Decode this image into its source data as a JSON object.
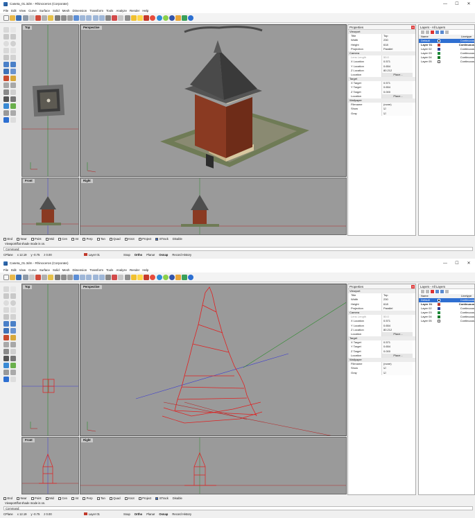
{
  "window": {
    "title": "Caseta_01.3dm - Rhinoceros (Corporate)",
    "minimize": "—",
    "maximize": "☐",
    "close": "✕"
  },
  "menu": [
    "File",
    "Edit",
    "View",
    "Curve",
    "Surface",
    "Solid",
    "Mesh",
    "Dimension",
    "Transform",
    "Tools",
    "Analyze",
    "Render",
    "Help"
  ],
  "viewports": {
    "top": "Top",
    "perspective": "Perspective",
    "front": "Front",
    "right": "Right"
  },
  "properties": {
    "title": "Properties",
    "close": "✕",
    "sections": {
      "viewport": "Viewport",
      "camera": "Camera",
      "target": "Target",
      "wallpaper": "Wallpaper"
    },
    "rows": {
      "title_k": "Title",
      "title_v": "Top",
      "width_k": "Width",
      "width_v": "230",
      "height_k": "Height",
      "height_v": "618",
      "projection_k": "Projection",
      "projection_v": "Parallel",
      "lens_k": "Lens Length",
      "lens_v": "50.0",
      "xloc_k": "X Location",
      "xloc_v": "0.571",
      "yloc_k": "Y Location",
      "yloc_v": "0.654",
      "zloc_k": "Z Location",
      "zloc_v": "80.212",
      "loc_k": "Location",
      "loc_v": "Place...",
      "xt_k": "X Target",
      "xt_v": "0.571",
      "yt_k": "Y Target",
      "yt_v": "0.654",
      "zt_k": "Z Target",
      "zt_v": "0.000",
      "tloc_k": "Location",
      "tloc_v": "Place...",
      "fname_k": "Filename",
      "fname_v": "(none)",
      "show_k": "Show",
      "show_v": "☑",
      "gray_k": "Gray",
      "gray_v": "☑"
    }
  },
  "layers": {
    "title": "Layers - All Layers",
    "header_name": "Name",
    "header_material": "Linetype",
    "items": [
      {
        "name": "Default",
        "linetype": "Continuous",
        "color": "#000000"
      },
      {
        "name": "Layer 01",
        "linetype": "Continuous",
        "color": "#c0392b"
      },
      {
        "name": "Layer 02",
        "linetype": "Continuous",
        "color": "#2c3e98"
      },
      {
        "name": "Layer 03",
        "linetype": "Continuous",
        "color": "#1e8a3a"
      },
      {
        "name": "Layer 04",
        "linetype": "Continuous",
        "color": "#1a7a2a"
      },
      {
        "name": "Layer 05",
        "linetype": "Continuous",
        "color": "#ffffff"
      }
    ]
  },
  "osnap": [
    "End",
    "Near",
    "Point",
    "Mid",
    "Cen",
    "Int",
    "Perp",
    "Tan",
    "Quad",
    "Knot",
    "Project",
    "STrack",
    "Disable"
  ],
  "command": {
    "history": "Viewport/flat shade mode is on.",
    "prompt": "Command:"
  },
  "status": {
    "cplane": "CPlane",
    "x": "x 12.19",
    "y": "y -0.75",
    "z": "z 0.00",
    "layer": "Layer 01",
    "snap": "Snap",
    "ortho": "Ortho",
    "planar": "Planar",
    "osnap": "Osnap",
    "record": "Record History"
  },
  "colors": {
    "viewport_bg": "#9a9a9a",
    "curve": "#e02020",
    "axis_x": "#b42828",
    "axis_y": "#2e8b2e",
    "axis_z": "#3a3ad0",
    "brick": "#8a3a22",
    "roof": "#5a5a5a",
    "accent": "#0078d7"
  }
}
